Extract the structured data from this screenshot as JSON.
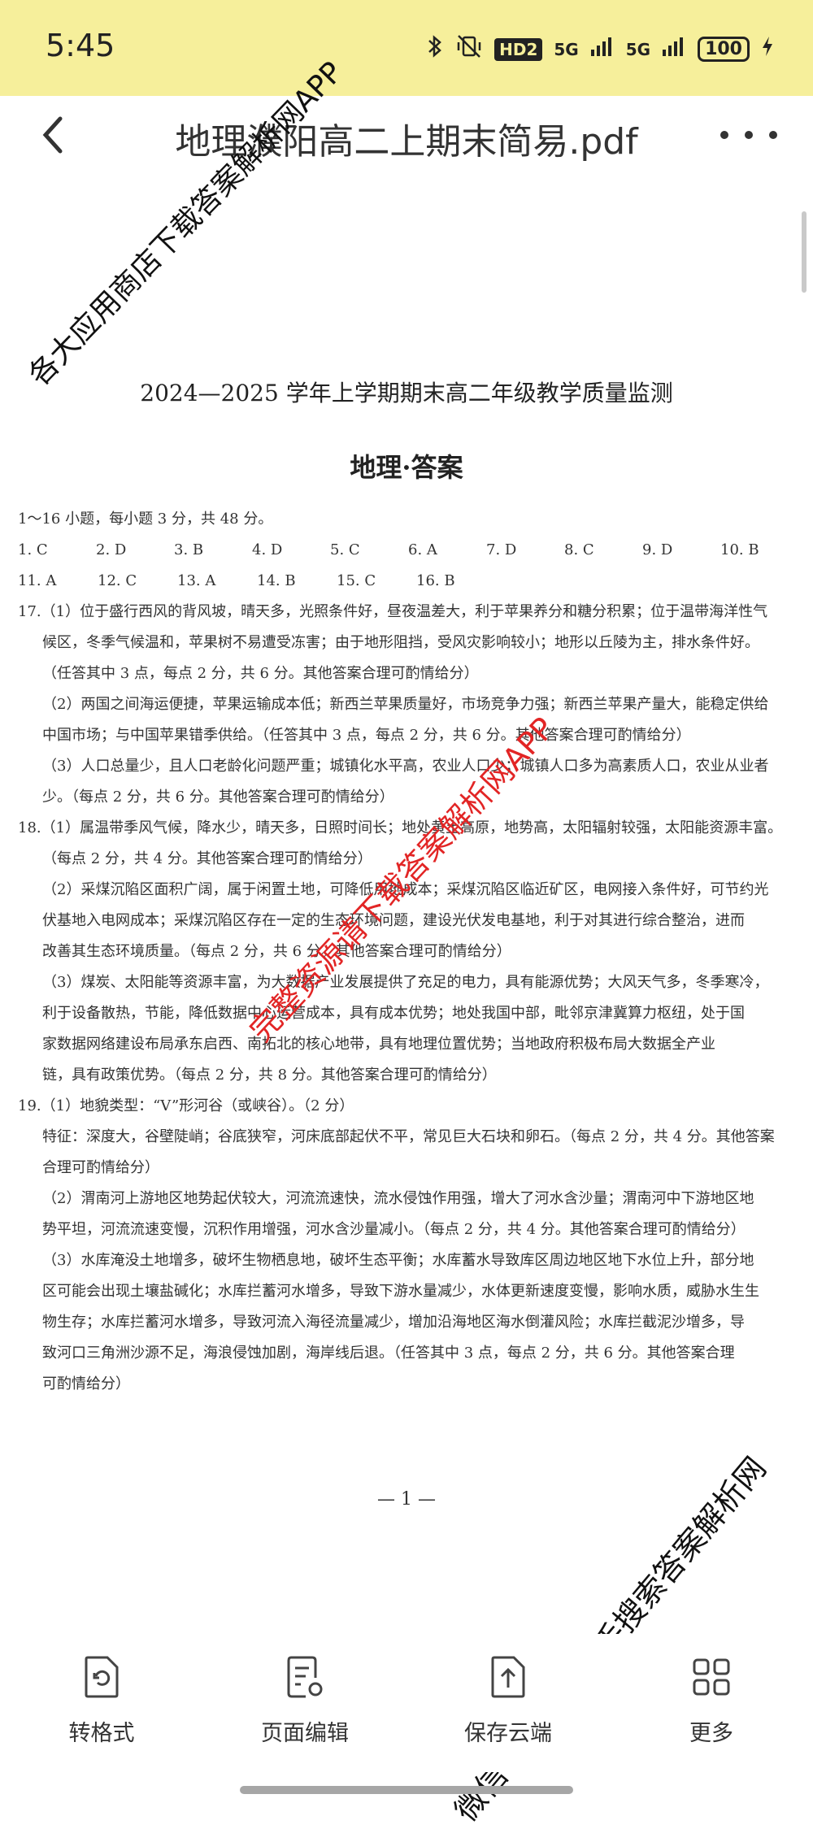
{
  "status_bar": {
    "time": "5:45",
    "bluetooth_icon": "bluetooth-icon",
    "mute_icon": "vibrate-off-icon",
    "hd_badge": "HD2",
    "signal1": "5G",
    "signal2": "5G",
    "battery": "100",
    "charging_icon": "bolt-icon",
    "bg_color": "#f6ef9b"
  },
  "header": {
    "title": "地理濮阳高二上期末简易.pdf",
    "back_icon": "chevron-left-icon",
    "more_icon": "more-horizontal-icon"
  },
  "document": {
    "heading": "2024—2025 学年上学期期末高二年级教学质量监测",
    "subheading": "地理·答案",
    "mc_intro": "1～16 小题，每小题 3 分，共 48 分。",
    "mc_row1": [
      "1. C",
      "2. D",
      "3. B",
      "4. D",
      "5. C",
      "6. A",
      "7. D",
      "8. C",
      "9. D",
      "10. B"
    ],
    "mc_row2": [
      "11. A",
      "12. C",
      "13. A",
      "14. B",
      "15. C",
      "16. B"
    ],
    "lines": [
      "17.（1）位于盛行西风的背风坡，晴天多，光照条件好，昼夜温差大，利于苹果养分和糖分积累；位于温带海洋性气",
      "候区，冬季气候温和，苹果树不易遭受冻害；由于地形阻挡，受风灾影响较小；地形以丘陵为主，排水条件好。",
      "（任答其中 3 点，每点 2 分，共 6 分。其他答案合理可酌情给分）",
      "（2）两国之间海运便捷，苹果运输成本低；新西兰苹果质量好，市场竞争力强；新西兰苹果产量大，能稳定供给",
      "中国市场；与中国苹果错季供给。（任答其中 3 点，每点 2 分，共 6 分。其他答案合理可酌情给分）",
      "（3）人口总量少，且人口老龄化问题严重；城镇化水平高，农业人口少；城镇人口多为高素质人口，农业从业者",
      "少。（每点 2 分，共 6 分。其他答案合理可酌情给分）",
      "18.（1）属温带季风气候，降水少，晴天多，日照时间长；地处黄土高原，地势高，太阳辐射较强，太阳能资源丰富。",
      "（每点 2 分，共 4 分。其他答案合理可酌情给分）",
      "（2）采煤沉陷区面积广阔，属于闲置土地，可降低用地成本；采煤沉陷区临近矿区，电网接入条件好，可节约光",
      "伏基地入电网成本；采煤沉陷区存在一定的生态环境问题，建设光伏发电基地，利于对其进行综合整治，进而",
      "改善其生态环境质量。（每点 2 分，共 6 分。其他答案合理可酌情给分）",
      "（3）煤炭、太阳能等资源丰富，为大数据产业发展提供了充足的电力，具有能源优势；大风天气多，冬季寒冷，",
      "利于设备散热，节能，降低数据中心运营成本，具有成本优势；地处我国中部，毗邻京津冀算力枢纽，处于国",
      "家数据网络建设布局承东启西、南拓北的核心地带，具有地理位置优势；当地政府积极布局大数据全产业",
      "链，具有政策优势。（每点 2 分，共 8 分。其他答案合理可酌情给分）",
      "19.（1）地貌类型：“V”形河谷（或峡谷）。（2 分）",
      "特征：深度大，谷壁陡峭；谷底狭窄，河床底部起伏不平，常见巨大石块和卵石。（每点 2 分，共 4 分。其他答案",
      "合理可酌情给分）",
      "（2）渭南河上游地区地势起伏较大，河流流速快，流水侵蚀作用强，增大了河水含沙量；渭南河中下游地区地",
      "势平坦，河流流速变慢，沉积作用增强，河水含沙量减小。（每点 2 分，共 4 分。其他答案合理可酌情给分）",
      "（3）水库淹没土地增多，破坏生物栖息地，破坏生态平衡；水库蓄水导致库区周边地区地下水位上升，部分地",
      "区可能会出现土壤盐碱化；水库拦蓄河水增多，导致下游水量减少，水体更新速度变慢，影响水质，威胁水生生",
      "物生存；水库拦蓄河水增多，导致河流入海径流量减少，增加沿海地区海水倒灌风险；水库拦截泥沙增多，导",
      "致河口三角洲沙源不足，海浪侵蚀加剧，海岸线后退。（任答其中 3 点，每点 2 分，共 6 分。其他答案合理",
      "可酌情给分）"
    ],
    "page_number": "— 1 —"
  },
  "watermarks": {
    "top_left": "各大应用商店下载答案解析网APP",
    "center": "完整资源请下载答案解析网APP",
    "bottom_right": "微信、抖音、快手搜索答案解析网"
  },
  "toolbar": {
    "convert_label": "转格式",
    "convert_icon": "file-convert-icon",
    "edit_label": "页面编辑",
    "edit_icon": "page-edit-icon",
    "cloud_label": "保存云端",
    "cloud_icon": "cloud-save-icon",
    "more_label": "更多",
    "more_icon": "grid-icon"
  },
  "colors": {
    "watermark_red": "#e22525",
    "text": "#333333"
  }
}
